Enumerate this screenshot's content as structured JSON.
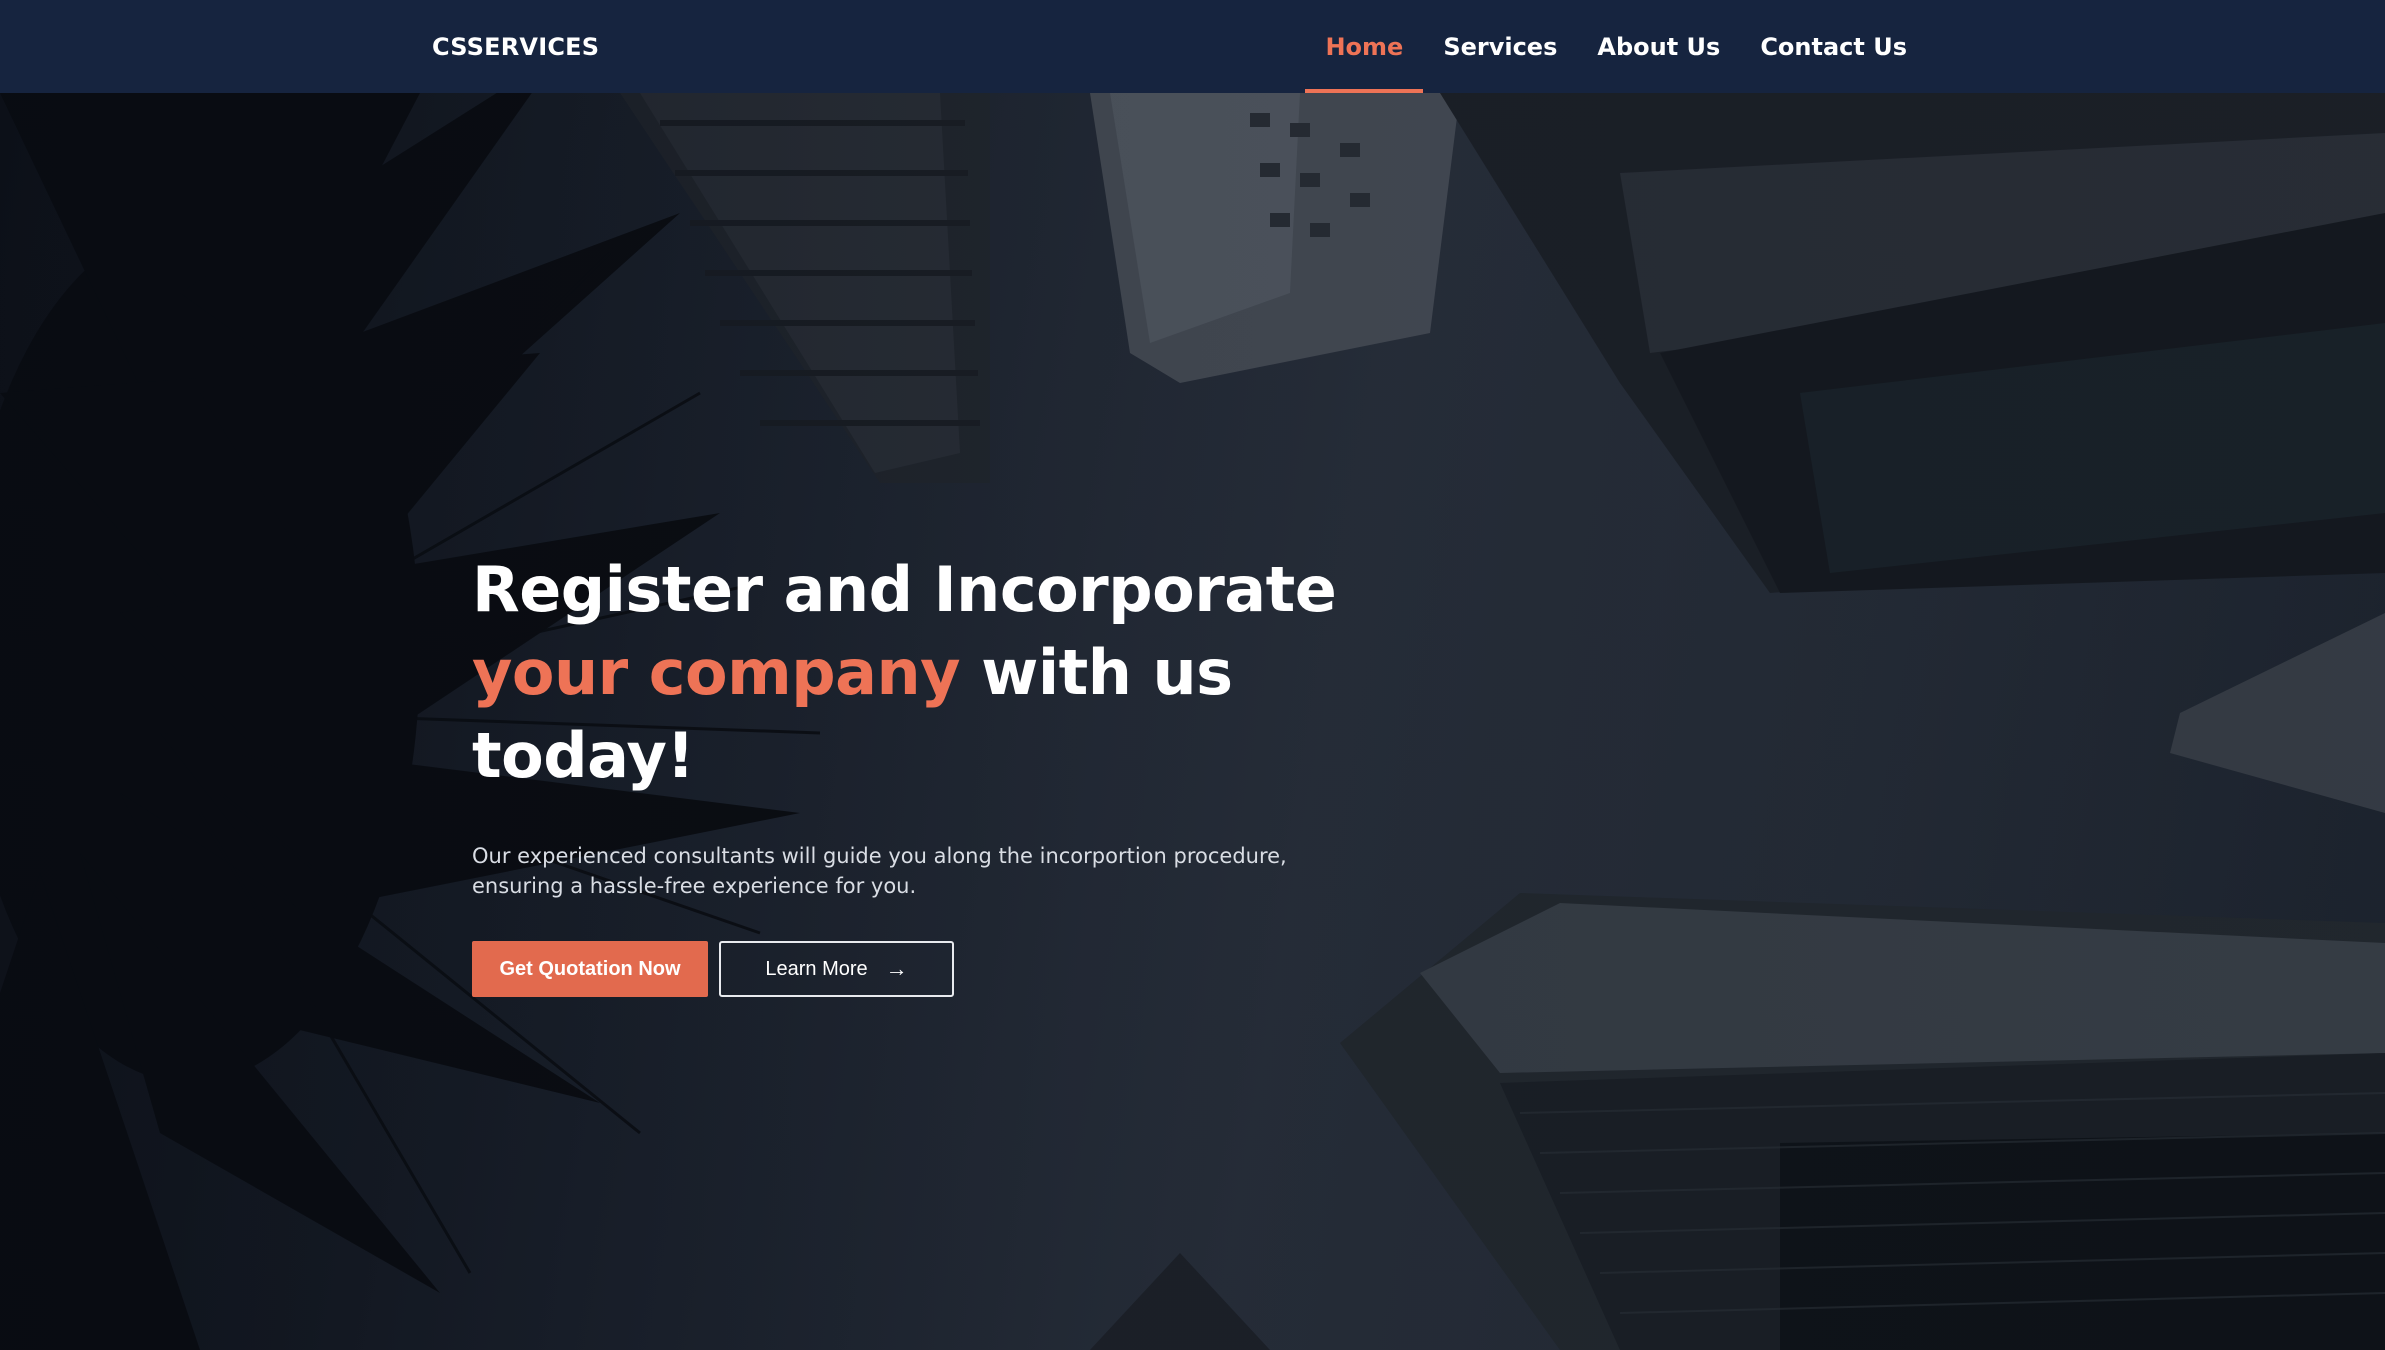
{
  "brand": {
    "name": "CSSERVICES"
  },
  "nav": {
    "items": [
      {
        "label": "Home",
        "active": true
      },
      {
        "label": "Services",
        "active": false
      },
      {
        "label": "About Us",
        "active": false
      },
      {
        "label": "Contact Us",
        "active": false
      }
    ]
  },
  "hero": {
    "title_part1": "Register and Incorporate",
    "title_accent": "your company",
    "title_part2": " with us",
    "title_part3": "today!",
    "subtitle": "Our experienced consultants will guide you along the incorportion procedure, ensuring a hassle-free experience for you.",
    "primary_button": "Get Quotation Now",
    "secondary_button": "Learn More",
    "secondary_icon": "arrow-right-icon",
    "background_image": "palm-tree-and-skyscrapers-photo"
  },
  "colors": {
    "navbar": "#16243f",
    "accent": "#ee7356",
    "button": "#e26a4e",
    "text": "#ffffff"
  }
}
